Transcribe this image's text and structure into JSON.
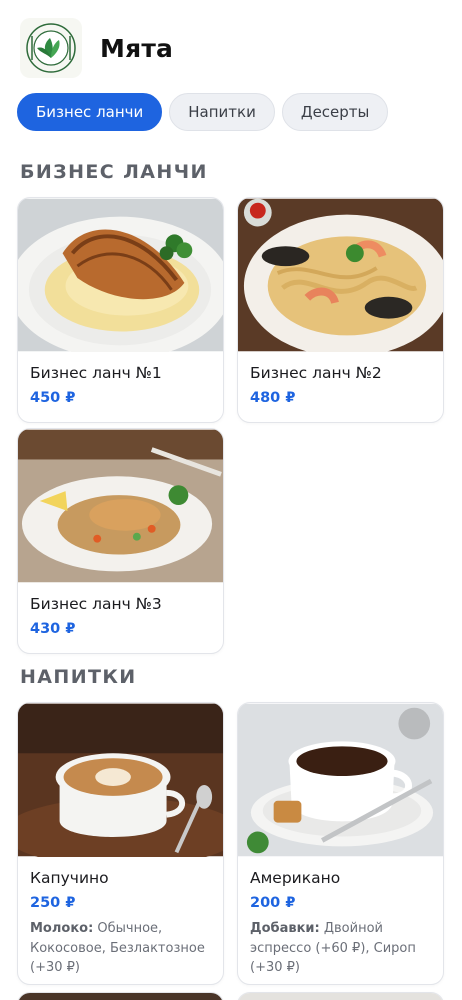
{
  "brand": {
    "name": "Мята",
    "logo_icon": "mint-leaf-plate-logo"
  },
  "tabs": [
    {
      "label": "Бизнес ланчи",
      "active": true
    },
    {
      "label": "Напитки",
      "active": false
    },
    {
      "label": "Десерты",
      "active": false
    }
  ],
  "sections": {
    "lunch": {
      "title": "БИЗНЕС ЛАНЧИ",
      "items": [
        {
          "name": "Бизнес ланч №1",
          "price": "450 ₽",
          "image": "grilled-chicken-mashed-potato"
        },
        {
          "name": "Бизнес ланч №2",
          "price": "480 ₽",
          "image": "seafood-pasta"
        },
        {
          "name": "Бизнес ланч №3",
          "price": "430 ₽",
          "image": "chicken-fried-rice"
        }
      ]
    },
    "drinks": {
      "title": "НАПИТКИ",
      "items": [
        {
          "name": "Капучино",
          "price": "250 ₽",
          "options_label": "Молоко:",
          "options_text": " Обычное, Кокосовое, Безлактозное (+30 ₽)",
          "image": "cappuccino-latte-art"
        },
        {
          "name": "Американо",
          "price": "200 ₽",
          "options_label": "Добавки:",
          "options_text": " Двойной эспрессо (+60 ₽), Сироп (+30 ₽)",
          "image": "americano-cup"
        }
      ]
    }
  },
  "colors": {
    "accent": "#1e64e0",
    "section_title": "#5d6169",
    "tab_inactive_bg": "#eef0f4"
  }
}
